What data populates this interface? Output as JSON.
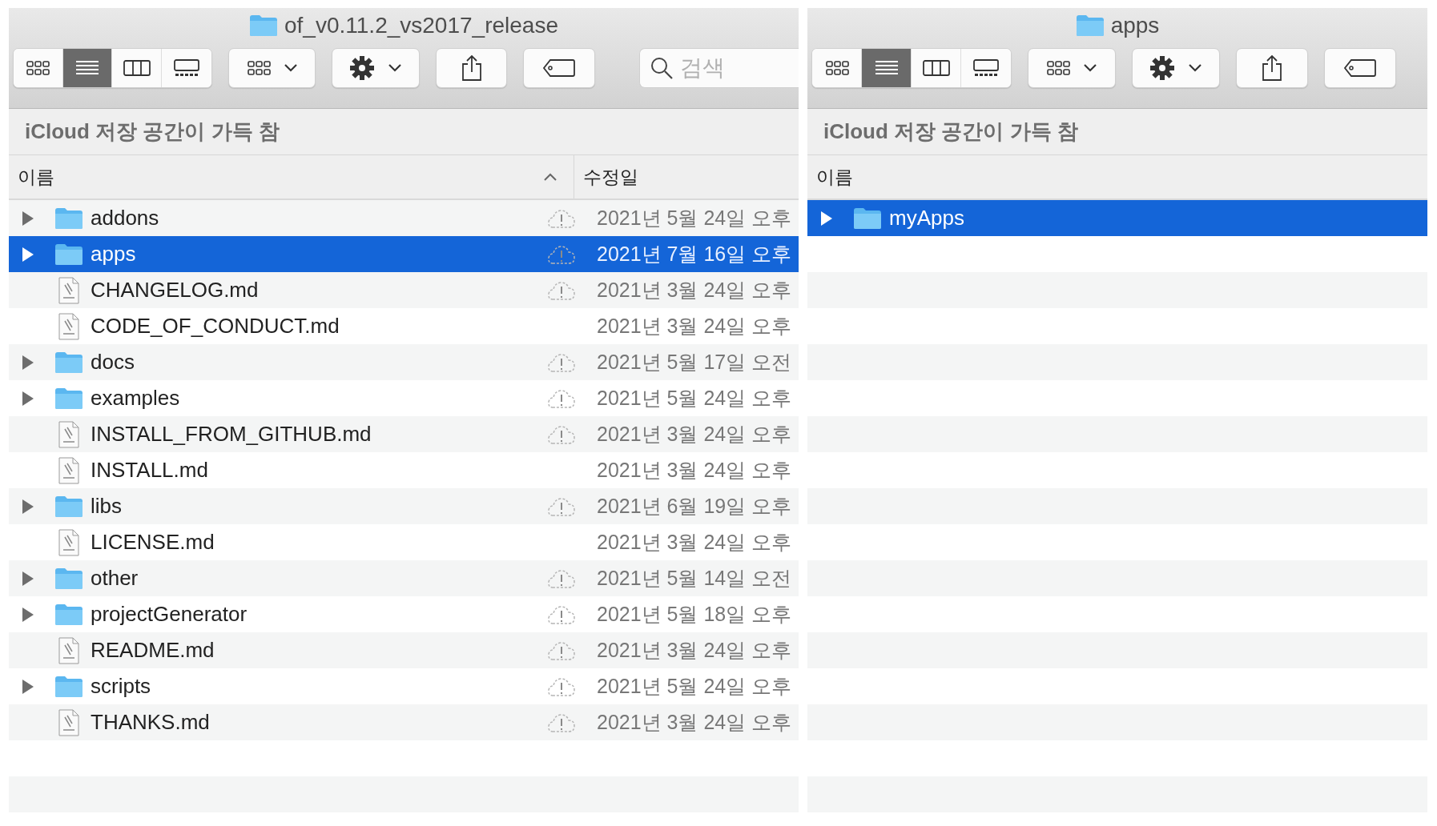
{
  "windows": [
    {
      "title": "of_v0.11.2_vs2017_release",
      "view_modes": [
        {
          "kind": "icons",
          "selected": false
        },
        {
          "kind": "list",
          "selected": true
        },
        {
          "kind": "columns",
          "selected": false
        },
        {
          "kind": "gallery",
          "selected": false
        }
      ],
      "search": {
        "placeholder": "검색"
      },
      "storage_notice": "iCloud 저장 공간이 가득 참",
      "columns": [
        {
          "label": "이름",
          "sorted": true
        },
        {
          "label": "수정일",
          "sorted": false
        }
      ],
      "rows": [
        {
          "name": "addons",
          "kind": "folder",
          "cloud_warning": true,
          "modified": "2021년 5월 24일 오후",
          "selected": false
        },
        {
          "name": "apps",
          "kind": "folder",
          "cloud_warning": true,
          "modified": "2021년 7월 16일 오후",
          "selected": true
        },
        {
          "name": "CHANGELOG.md",
          "kind": "file",
          "cloud_warning": true,
          "modified": "2021년 3월 24일 오후",
          "selected": false
        },
        {
          "name": "CODE_OF_CONDUCT.md",
          "kind": "file",
          "cloud_warning": false,
          "modified": "2021년 3월 24일 오후",
          "selected": false
        },
        {
          "name": "docs",
          "kind": "folder",
          "cloud_warning": true,
          "modified": "2021년 5월 17일 오전",
          "selected": false
        },
        {
          "name": "examples",
          "kind": "folder",
          "cloud_warning": true,
          "modified": "2021년 5월 24일 오후",
          "selected": false
        },
        {
          "name": "INSTALL_FROM_GITHUB.md",
          "kind": "file",
          "cloud_warning": true,
          "modified": "2021년 3월 24일 오후",
          "selected": false
        },
        {
          "name": "INSTALL.md",
          "kind": "file",
          "cloud_warning": false,
          "modified": "2021년 3월 24일 오후",
          "selected": false
        },
        {
          "name": "libs",
          "kind": "folder",
          "cloud_warning": true,
          "modified": "2021년 6월 19일 오후",
          "selected": false
        },
        {
          "name": "LICENSE.md",
          "kind": "file",
          "cloud_warning": false,
          "modified": "2021년 3월 24일 오후",
          "selected": false
        },
        {
          "name": "other",
          "kind": "folder",
          "cloud_warning": true,
          "modified": "2021년 5월 14일 오전",
          "selected": false
        },
        {
          "name": "projectGenerator",
          "kind": "folder",
          "cloud_warning": true,
          "modified": "2021년 5월 18일 오후",
          "selected": false
        },
        {
          "name": "README.md",
          "kind": "file",
          "cloud_warning": true,
          "modified": "2021년 3월 24일 오후",
          "selected": false
        },
        {
          "name": "scripts",
          "kind": "folder",
          "cloud_warning": true,
          "modified": "2021년 5월 24일 오후",
          "selected": false
        },
        {
          "name": "THANKS.md",
          "kind": "file",
          "cloud_warning": true,
          "modified": "2021년 3월 24일 오후",
          "selected": false
        }
      ]
    },
    {
      "title": "apps",
      "view_modes": [
        {
          "kind": "icons",
          "selected": false
        },
        {
          "kind": "list",
          "selected": true
        },
        {
          "kind": "columns",
          "selected": false
        },
        {
          "kind": "gallery",
          "selected": false
        }
      ],
      "storage_notice": "iCloud 저장 공간이 가득 참",
      "columns": [
        {
          "label": "이름",
          "sorted": false
        }
      ],
      "rows": [
        {
          "name": "myApps",
          "kind": "folder",
          "selected": true
        }
      ]
    }
  ]
}
